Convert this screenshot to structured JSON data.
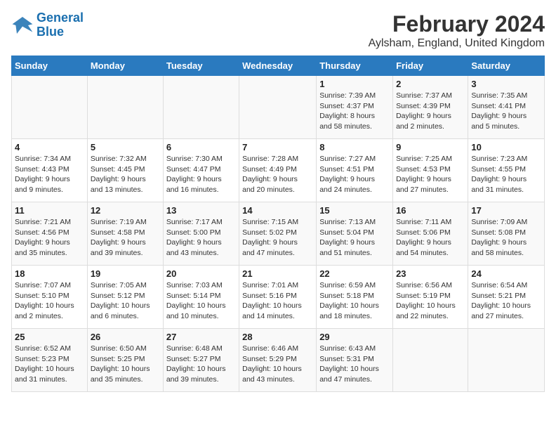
{
  "header": {
    "logo_line1": "General",
    "logo_line2": "Blue",
    "month_year": "February 2024",
    "location": "Aylsham, England, United Kingdom"
  },
  "weekdays": [
    "Sunday",
    "Monday",
    "Tuesday",
    "Wednesday",
    "Thursday",
    "Friday",
    "Saturday"
  ],
  "weeks": [
    [
      {
        "day": "",
        "info": ""
      },
      {
        "day": "",
        "info": ""
      },
      {
        "day": "",
        "info": ""
      },
      {
        "day": "",
        "info": ""
      },
      {
        "day": "1",
        "info": "Sunrise: 7:39 AM\nSunset: 4:37 PM\nDaylight: 8 hours\nand 58 minutes."
      },
      {
        "day": "2",
        "info": "Sunrise: 7:37 AM\nSunset: 4:39 PM\nDaylight: 9 hours\nand 2 minutes."
      },
      {
        "day": "3",
        "info": "Sunrise: 7:35 AM\nSunset: 4:41 PM\nDaylight: 9 hours\nand 5 minutes."
      }
    ],
    [
      {
        "day": "4",
        "info": "Sunrise: 7:34 AM\nSunset: 4:43 PM\nDaylight: 9 hours\nand 9 minutes."
      },
      {
        "day": "5",
        "info": "Sunrise: 7:32 AM\nSunset: 4:45 PM\nDaylight: 9 hours\nand 13 minutes."
      },
      {
        "day": "6",
        "info": "Sunrise: 7:30 AM\nSunset: 4:47 PM\nDaylight: 9 hours\nand 16 minutes."
      },
      {
        "day": "7",
        "info": "Sunrise: 7:28 AM\nSunset: 4:49 PM\nDaylight: 9 hours\nand 20 minutes."
      },
      {
        "day": "8",
        "info": "Sunrise: 7:27 AM\nSunset: 4:51 PM\nDaylight: 9 hours\nand 24 minutes."
      },
      {
        "day": "9",
        "info": "Sunrise: 7:25 AM\nSunset: 4:53 PM\nDaylight: 9 hours\nand 27 minutes."
      },
      {
        "day": "10",
        "info": "Sunrise: 7:23 AM\nSunset: 4:55 PM\nDaylight: 9 hours\nand 31 minutes."
      }
    ],
    [
      {
        "day": "11",
        "info": "Sunrise: 7:21 AM\nSunset: 4:56 PM\nDaylight: 9 hours\nand 35 minutes."
      },
      {
        "day": "12",
        "info": "Sunrise: 7:19 AM\nSunset: 4:58 PM\nDaylight: 9 hours\nand 39 minutes."
      },
      {
        "day": "13",
        "info": "Sunrise: 7:17 AM\nSunset: 5:00 PM\nDaylight: 9 hours\nand 43 minutes."
      },
      {
        "day": "14",
        "info": "Sunrise: 7:15 AM\nSunset: 5:02 PM\nDaylight: 9 hours\nand 47 minutes."
      },
      {
        "day": "15",
        "info": "Sunrise: 7:13 AM\nSunset: 5:04 PM\nDaylight: 9 hours\nand 51 minutes."
      },
      {
        "day": "16",
        "info": "Sunrise: 7:11 AM\nSunset: 5:06 PM\nDaylight: 9 hours\nand 54 minutes."
      },
      {
        "day": "17",
        "info": "Sunrise: 7:09 AM\nSunset: 5:08 PM\nDaylight: 9 hours\nand 58 minutes."
      }
    ],
    [
      {
        "day": "18",
        "info": "Sunrise: 7:07 AM\nSunset: 5:10 PM\nDaylight: 10 hours\nand 2 minutes."
      },
      {
        "day": "19",
        "info": "Sunrise: 7:05 AM\nSunset: 5:12 PM\nDaylight: 10 hours\nand 6 minutes."
      },
      {
        "day": "20",
        "info": "Sunrise: 7:03 AM\nSunset: 5:14 PM\nDaylight: 10 hours\nand 10 minutes."
      },
      {
        "day": "21",
        "info": "Sunrise: 7:01 AM\nSunset: 5:16 PM\nDaylight: 10 hours\nand 14 minutes."
      },
      {
        "day": "22",
        "info": "Sunrise: 6:59 AM\nSunset: 5:18 PM\nDaylight: 10 hours\nand 18 minutes."
      },
      {
        "day": "23",
        "info": "Sunrise: 6:56 AM\nSunset: 5:19 PM\nDaylight: 10 hours\nand 22 minutes."
      },
      {
        "day": "24",
        "info": "Sunrise: 6:54 AM\nSunset: 5:21 PM\nDaylight: 10 hours\nand 27 minutes."
      }
    ],
    [
      {
        "day": "25",
        "info": "Sunrise: 6:52 AM\nSunset: 5:23 PM\nDaylight: 10 hours\nand 31 minutes."
      },
      {
        "day": "26",
        "info": "Sunrise: 6:50 AM\nSunset: 5:25 PM\nDaylight: 10 hours\nand 35 minutes."
      },
      {
        "day": "27",
        "info": "Sunrise: 6:48 AM\nSunset: 5:27 PM\nDaylight: 10 hours\nand 39 minutes."
      },
      {
        "day": "28",
        "info": "Sunrise: 6:46 AM\nSunset: 5:29 PM\nDaylight: 10 hours\nand 43 minutes."
      },
      {
        "day": "29",
        "info": "Sunrise: 6:43 AM\nSunset: 5:31 PM\nDaylight: 10 hours\nand 47 minutes."
      },
      {
        "day": "",
        "info": ""
      },
      {
        "day": "",
        "info": ""
      }
    ]
  ]
}
